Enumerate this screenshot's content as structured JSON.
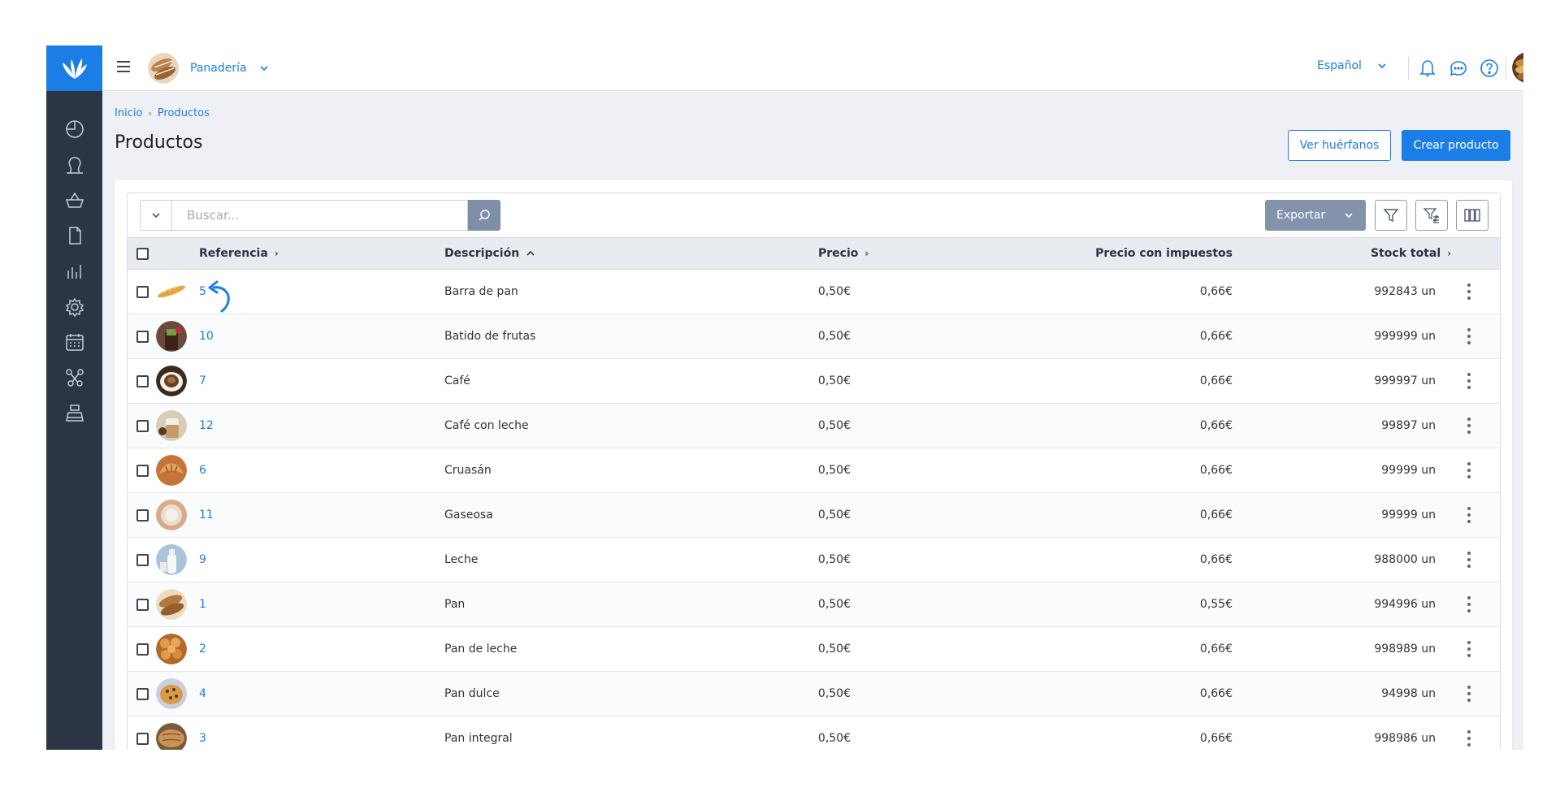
{
  "topbar": {
    "store_name": "Panadería",
    "language": "Español"
  },
  "breadcrumb": {
    "home": "Inicio",
    "current": "Productos"
  },
  "page": {
    "title": "Productos",
    "orphans_button": "Ver huérfanos",
    "create_button": "Crear producto"
  },
  "toolbar": {
    "search_placeholder": "Buscar...",
    "export_label": "Exportar"
  },
  "table": {
    "headers": {
      "reference": "Referencia",
      "description": "Descripción",
      "price": "Precio",
      "price_tax": "Precio con impuestos",
      "stock": "Stock total"
    },
    "rows": [
      {
        "ref": "5",
        "desc": "Barra de pan",
        "price": "0,50€",
        "price_tax": "0,66€",
        "stock": "992843 un",
        "thumb": "baguette"
      },
      {
        "ref": "10",
        "desc": "Batido de frutas",
        "price": "0,50€",
        "price_tax": "0,66€",
        "stock": "999999 un",
        "thumb": "smoothie"
      },
      {
        "ref": "7",
        "desc": "Café",
        "price": "0,50€",
        "price_tax": "0,66€",
        "stock": "999997 un",
        "thumb": "coffee"
      },
      {
        "ref": "12",
        "desc": "Café con leche",
        "price": "0,50€",
        "price_tax": "0,66€",
        "stock": "99897 un",
        "thumb": "latte"
      },
      {
        "ref": "6",
        "desc": "Cruasán",
        "price": "0,50€",
        "price_tax": "0,66€",
        "stock": "99999 un",
        "thumb": "croissant"
      },
      {
        "ref": "11",
        "desc": "Gaseosa",
        "price": "0,50€",
        "price_tax": "0,66€",
        "stock": "99999 un",
        "thumb": "soda"
      },
      {
        "ref": "9",
        "desc": "Leche",
        "price": "0,50€",
        "price_tax": "0,66€",
        "stock": "988000 un",
        "thumb": "milk"
      },
      {
        "ref": "1",
        "desc": "Pan",
        "price": "0,50€",
        "price_tax": "0,55€",
        "stock": "994996 un",
        "thumb": "bread"
      },
      {
        "ref": "2",
        "desc": "Pan de leche",
        "price": "0,50€",
        "price_tax": "0,66€",
        "stock": "998989 un",
        "thumb": "milk-bread"
      },
      {
        "ref": "4",
        "desc": "Pan dulce",
        "price": "0,50€",
        "price_tax": "0,66€",
        "stock": "94998 un",
        "thumb": "sweet-bread"
      },
      {
        "ref": "3",
        "desc": "Pan integral",
        "price": "0,50€",
        "price_tax": "0,66€",
        "stock": "998986 un",
        "thumb": "whole-bread"
      }
    ]
  },
  "colors": {
    "accent": "#1a7ee6",
    "sidebar": "#2b3544",
    "content_bg": "#eef0f5",
    "header_row": "#e8ebf0",
    "export_button": "#8293ab"
  },
  "icons": {
    "sidebar": [
      "dashboard-icon",
      "user-icon",
      "basket-icon",
      "document-icon",
      "chart-icon",
      "gear-icon",
      "calendar-icon",
      "integrations-icon",
      "register-icon"
    ],
    "topbar": [
      "menu-icon",
      "bell-icon",
      "chat-icon",
      "help-icon",
      "kebab-icon"
    ]
  }
}
